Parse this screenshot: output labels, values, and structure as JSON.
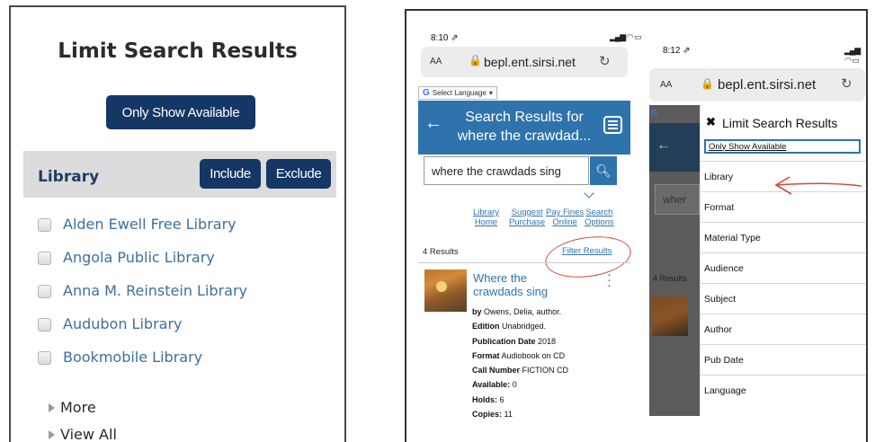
{
  "desktop_panel": {
    "title": "Limit Search Results",
    "only_show_available_label": "Only Show Available",
    "library_heading": "Library",
    "include_label": "Include",
    "exclude_label": "Exclude",
    "libraries": [
      "Alden Ewell Free Library",
      "Angola Public Library",
      "Anna M. Reinstein Library",
      "Audubon Library",
      "Bookmobile Library"
    ],
    "more_label": "More",
    "view_all_label": "View All"
  },
  "phone_results": {
    "status_time": "8:10 ⇗",
    "status_icons": "▂▄▆ ◠ ▭",
    "aa": "AA",
    "url": "bepl.ent.sirsi.net",
    "translate_label": "Select Language",
    "header_title_line1": "Search Results for",
    "header_title_line2": "where the crawdad...",
    "search_value": "where the crawdads sing",
    "nav": [
      {
        "line1": "Library",
        "line2": "Home"
      },
      {
        "line1": "Suggest",
        "line2": "Purchase"
      },
      {
        "line1": "Pay Fines",
        "line2": "Online"
      },
      {
        "line1": "Search",
        "line2": "Options"
      }
    ],
    "result_count": "4 Results",
    "filter_results": "Filter Results",
    "book_title": "Where the crawdads sing",
    "details": [
      {
        "label": "by",
        "value": "Owens, Delia, author."
      },
      {
        "label": "Edition",
        "value": "Unabridged."
      },
      {
        "label": "Publication Date",
        "value": "2018"
      },
      {
        "label": "Format",
        "value": "Audiobook on CD"
      },
      {
        "label": "Call Number",
        "value": "FICTION CD"
      },
      {
        "label": "Available:",
        "value": "0"
      },
      {
        "label": "Holds:",
        "value": "6"
      },
      {
        "label": "Copies:",
        "value": "11"
      }
    ]
  },
  "phone_limit": {
    "status_time": "8:12 ⇗",
    "status_icons": "▂▄▆ ◠ ▭",
    "aa": "AA",
    "url": "bepl.ent.sirsi.net",
    "background_count": "4 Results",
    "background_search_fragment": "wher",
    "drawer_title": "Limit Search Results",
    "only_show_available_label": "Only Show Available",
    "facets": [
      "Library",
      "Format",
      "Material Type",
      "Audience",
      "Subject",
      "Author",
      "Pub Date",
      "Language"
    ]
  },
  "colors": {
    "button_navy": "#143766",
    "header_blue": "#2f73ad",
    "link_blue": "#3e6f9e",
    "annotation_red": "#d24a3a"
  }
}
